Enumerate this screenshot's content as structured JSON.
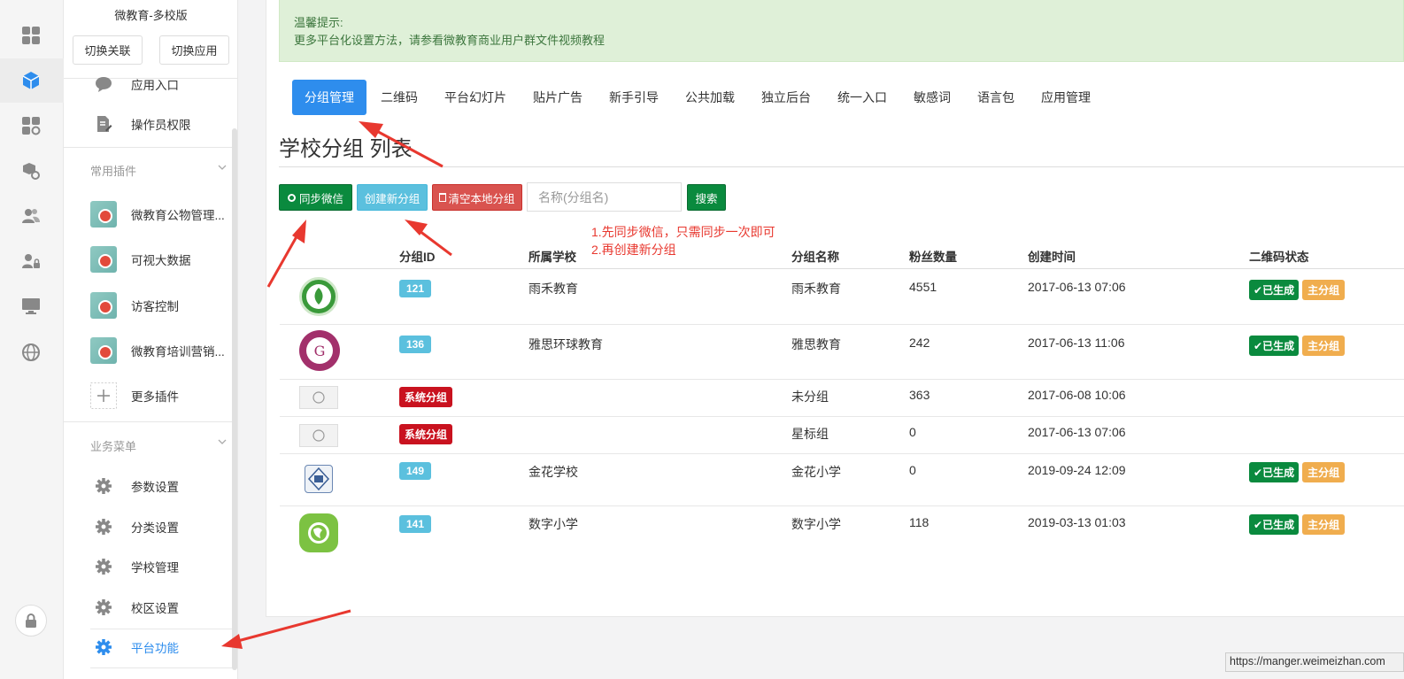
{
  "sidebar": {
    "title": "微教育-多校版",
    "switch_link_label": "切换关联",
    "switch_app_label": "切换应用",
    "top_items": [
      {
        "label": "应用入口",
        "icon": "chat-bubble-icon"
      },
      {
        "label": "操作员权限",
        "icon": "edit-document-icon"
      }
    ],
    "plugins_group": "常用插件",
    "plugins": [
      {
        "label": "微教育公物管理..."
      },
      {
        "label": "可视大数据"
      },
      {
        "label": "访客控制"
      },
      {
        "label": "微教育培训营销..."
      }
    ],
    "more_plugins": "更多插件",
    "business_group": "业务菜单",
    "business_items": [
      {
        "label": "参数设置"
      },
      {
        "label": "分类设置"
      },
      {
        "label": "学校管理"
      },
      {
        "label": "校区设置"
      },
      {
        "label": "平台功能"
      }
    ]
  },
  "alert": {
    "title": "温馨提示:",
    "body": "更多平台化设置方法，请参看微教育商业用户群文件视频教程"
  },
  "tabs": [
    "分组管理",
    "二维码",
    "平台幻灯片",
    "贴片广告",
    "新手引导",
    "公共加载",
    "独立后台",
    "统一入口",
    "敏感词",
    "语言包",
    "应用管理"
  ],
  "page_title": "学校分组 列表",
  "toolbar": {
    "sync_label": "同步微信",
    "create_label": "创建新分组",
    "clear_label": "清空本地分组",
    "search_placeholder": "名称(分组名)",
    "search_label": "搜索"
  },
  "annotation": {
    "line1": "1.先同步微信，只需同步一次即可",
    "line2": "2.再创建新分组"
  },
  "table": {
    "headers": [
      "分组ID",
      "所属学校",
      "分组名称",
      "粉丝数量",
      "创建时间",
      "二维码状态"
    ],
    "rows": [
      {
        "id": "121",
        "school": "雨禾教育",
        "name": "雨禾教育",
        "fans": "4551",
        "time": "2017-06-13 07:06",
        "status": "已生成",
        "tag": "主分组"
      },
      {
        "id": "136",
        "school": "雅思环球教育",
        "name": "雅思教育",
        "fans": "242",
        "time": "2017-06-13 11:06",
        "status": "已生成",
        "tag": "主分组"
      },
      {
        "id": "系统分组",
        "school": "",
        "name": "未分组",
        "fans": "363",
        "time": "2017-06-08 10:06",
        "status": "",
        "tag": ""
      },
      {
        "id": "系统分组",
        "school": "",
        "name": "星标组",
        "fans": "0",
        "time": "2017-06-13 07:06",
        "status": "",
        "tag": ""
      },
      {
        "id": "149",
        "school": "金花学校",
        "name": "金花小学",
        "fans": "0",
        "time": "2019-09-24 12:09",
        "status": "已生成",
        "tag": "主分组"
      },
      {
        "id": "141",
        "school": "数字小学",
        "name": "数字小学",
        "fans": "118",
        "time": "2019-03-13 01:03",
        "status": "已生成",
        "tag": "主分组"
      }
    ]
  },
  "status_url": "https://manger.weimeizhan.com"
}
